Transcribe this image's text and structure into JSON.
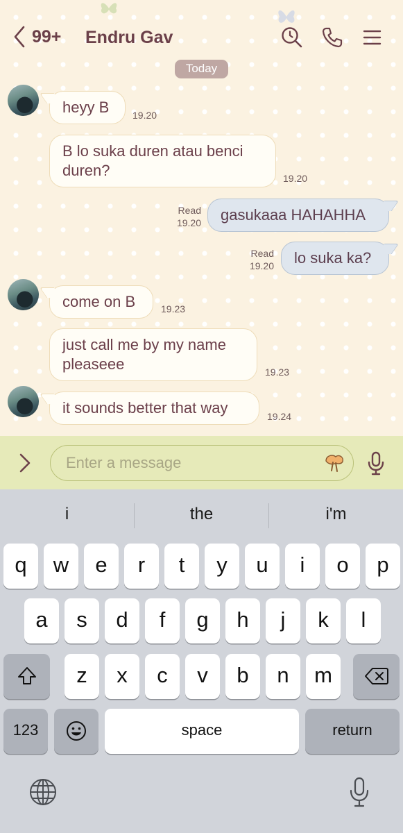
{
  "header": {
    "back_count": "99+",
    "contact_name": "Endru Gav",
    "icons": [
      "chevron-left-icon",
      "search-clock-icon",
      "phone-icon",
      "menu-icon"
    ]
  },
  "date_divider": "Today",
  "messages": [
    {
      "side": "in",
      "text": "heyy B",
      "time": "19.20"
    },
    {
      "side": "in",
      "text": "B lo suka duren atau benci duren?",
      "time": "19.20"
    },
    {
      "side": "out",
      "text": "gasukaaa HAHAHHA",
      "read": "Read",
      "time": "19.20"
    },
    {
      "side": "out",
      "text": "lo suka ka?",
      "read": "Read",
      "time": "19.20"
    },
    {
      "side": "in",
      "text": "come on B",
      "time": "19.23"
    },
    {
      "side": "in",
      "text": "just call me by my name pleaseee",
      "time": "19.23"
    },
    {
      "side": "in",
      "text": "it sounds better that way",
      "time": "19.24"
    }
  ],
  "input": {
    "placeholder": "Enter a message"
  },
  "keyboard": {
    "suggestions": [
      "i",
      "the",
      "i'm"
    ],
    "row1": [
      "q",
      "w",
      "e",
      "r",
      "t",
      "y",
      "u",
      "i",
      "o",
      "p"
    ],
    "row2": [
      "a",
      "s",
      "d",
      "f",
      "g",
      "h",
      "j",
      "k",
      "l"
    ],
    "row3": [
      "z",
      "x",
      "c",
      "v",
      "b",
      "n",
      "m"
    ],
    "numbers_label": "123",
    "space_label": "space",
    "return_label": "return"
  },
  "colors": {
    "accent": "#6b4049",
    "chat_background": "#fbf2e1",
    "input_bar": "#e6eab9",
    "incoming_bubble": "#fffdf6",
    "outgoing_bubble": "#dfe6ee",
    "keyboard": "#d1d4da"
  }
}
